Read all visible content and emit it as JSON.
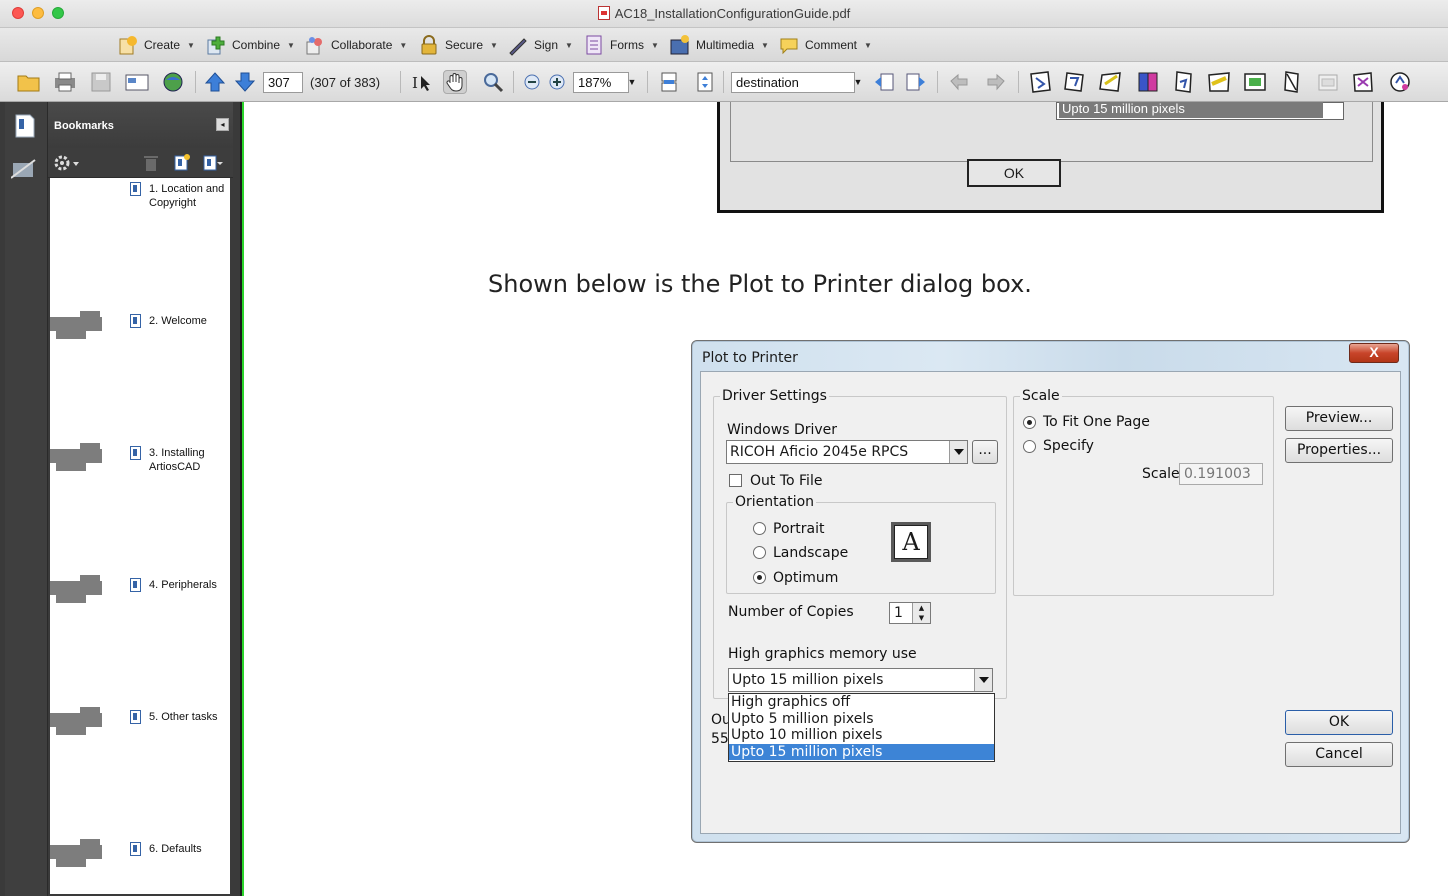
{
  "window": {
    "title": "AC18_InstallationConfigurationGuide.pdf"
  },
  "tasks": [
    {
      "label": "Create",
      "icon": "create-icon"
    },
    {
      "label": "Combine",
      "icon": "combine-icon"
    },
    {
      "label": "Collaborate",
      "icon": "collaborate-icon"
    },
    {
      "label": "Secure",
      "icon": "lock-icon"
    },
    {
      "label": "Sign",
      "icon": "pen-icon"
    },
    {
      "label": "Forms",
      "icon": "form-icon"
    },
    {
      "label": "Multimedia",
      "icon": "multimedia-icon"
    },
    {
      "label": "Comment",
      "icon": "comment-icon"
    }
  ],
  "toolbar": {
    "page_number": "307",
    "page_count": "(307 of 383)",
    "zoom": "187%",
    "find_text": "destination"
  },
  "sidebar": {
    "title": "Bookmarks",
    "bookmarks": [
      {
        "label": "1. Location and Copyright"
      },
      {
        "label": "2. Welcome"
      },
      {
        "label": "3. Installing ArtiosCAD"
      },
      {
        "label": "4. Peripherals"
      },
      {
        "label": "5. Other tasks"
      },
      {
        "label": "6. Defaults"
      }
    ]
  },
  "document": {
    "top_screenshot": {
      "selected_value": "Upto 15 million pixels",
      "ok_label": "OK"
    },
    "caption": "Shown below is the Plot to Printer dialog box.",
    "dialog": {
      "title": "Plot to Printer",
      "close_label": "X",
      "driver_settings": {
        "legend": "Driver Settings",
        "windows_driver_label": "Windows Driver",
        "windows_driver_value": "RICOH Aficio 2045e RPCS",
        "browse_label": "...",
        "out_to_file_label": "Out To File",
        "orientation": {
          "legend": "Orientation",
          "options": [
            "Portrait",
            "Landscape",
            "Optimum"
          ],
          "selected": "Optimum",
          "icon_letter": "A"
        },
        "copies_label": "Number of Copies",
        "copies_value": "1",
        "memory_label": "High graphics memory use",
        "memory_value": "Upto 15 million pixels",
        "memory_options": [
          "High graphics off",
          "Upto 5 million pixels",
          "Upto 10 million pixels",
          "Upto 15 million pixels"
        ],
        "hidden_text_1": "Ou",
        "hidden_text_2": "55"
      },
      "scale": {
        "legend": "Scale",
        "fit_label": "To Fit One Page",
        "specify_label": "Specify",
        "scale_label": "Scale",
        "scale_value": "0.191003"
      },
      "buttons": {
        "preview": "Preview...",
        "properties": "Properties...",
        "ok": "OK",
        "cancel": "Cancel"
      }
    }
  },
  "colors": {
    "sidebar_bg": "#3a3a3a",
    "selection_blue": "#3d84d6",
    "dialog_close_red": "#c8452a"
  }
}
